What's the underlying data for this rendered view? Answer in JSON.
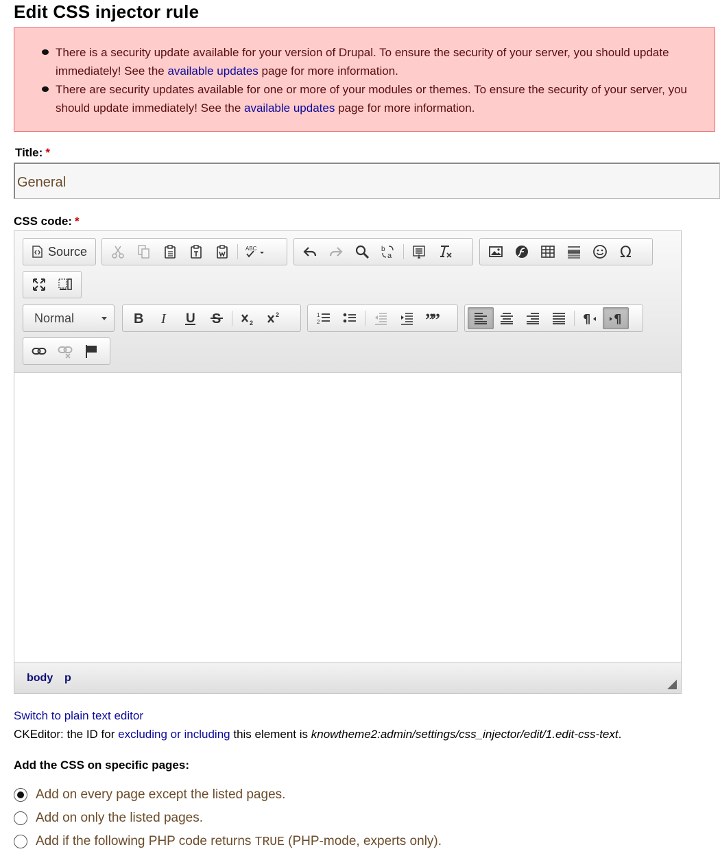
{
  "page": {
    "title": "Edit CSS injector rule"
  },
  "messages": [
    {
      "before": "There is a security update available for your version of Drupal. To ensure the security of your server, you should update immediately! See the ",
      "link": "available updates",
      "after": " page for more information."
    },
    {
      "before": "There are security updates available for one or more of your modules or themes. To ensure the security of your server, you should update immediately! See the ",
      "link": "available updates",
      "after": " page for more information."
    }
  ],
  "form": {
    "title_label": "Title:",
    "required_mark": "*",
    "title_value": "General",
    "css_label": "CSS code:"
  },
  "editor": {
    "source_label": "Source",
    "format_value": "Normal",
    "path": [
      "body",
      "p"
    ]
  },
  "below_editor": {
    "switch_link": "Switch to plain text editor",
    "desc_before": "CKEditor: the ID for ",
    "desc_link": "excluding or including",
    "desc_middle": " this element is ",
    "desc_id": "knowtheme2:admin/settings/css_injector/edit/1.edit-css-text",
    "desc_end": "."
  },
  "pages": {
    "label": "Add the CSS on specific pages:",
    "options": [
      {
        "label": "Add on every page except the listed pages.",
        "selected": true
      },
      {
        "label": "Add on only the listed pages.",
        "selected": false
      },
      {
        "before": "Add if the following PHP code returns ",
        "code": "TRUE",
        "after": " (PHP-mode, experts only).",
        "selected": false
      }
    ]
  }
}
